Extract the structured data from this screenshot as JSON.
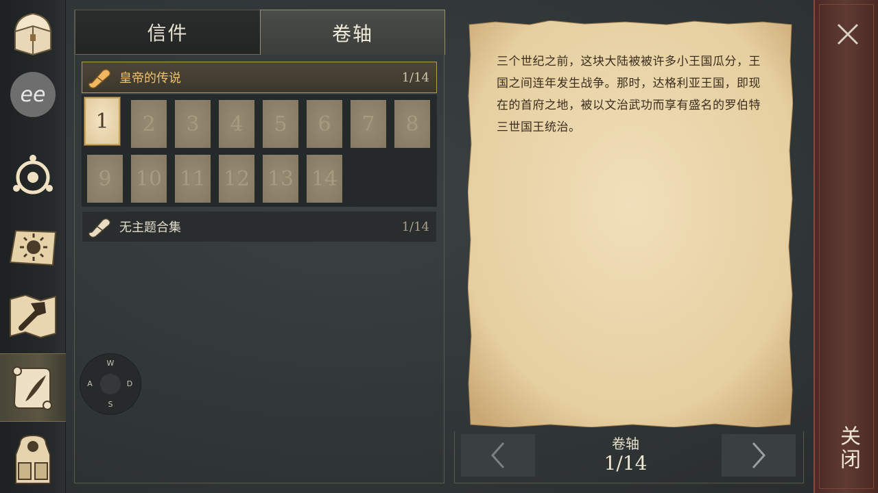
{
  "sidebar": {
    "items": [
      {
        "name": "chest-icon",
        "active": false
      },
      {
        "name": "ee-logo-icon",
        "active": false
      },
      {
        "name": "rune-circle-icon",
        "active": false
      },
      {
        "name": "sun-book-icon",
        "active": false
      },
      {
        "name": "map-hammer-icon",
        "active": false
      },
      {
        "name": "scroll-quill-icon",
        "active": true
      },
      {
        "name": "backpack-icon",
        "active": false
      }
    ]
  },
  "tabs": {
    "letters": "信件",
    "scrolls": "卷轴",
    "active": "scrolls"
  },
  "categories": [
    {
      "title": "皇帝的传说",
      "count": "1/14",
      "selected": true
    },
    {
      "title": "无主题合集",
      "count": "1/14",
      "selected": false
    }
  ],
  "pages": {
    "row1": [
      "1",
      "2",
      "3",
      "4",
      "5",
      "6",
      "7",
      "8"
    ],
    "row2": [
      "9",
      "10",
      "11",
      "12",
      "13",
      "14"
    ],
    "read_count": 1
  },
  "compass": {
    "up": "W",
    "left": "A",
    "right": "D",
    "down": "S"
  },
  "document": {
    "text": "三个世纪之前，这块大陆被被许多小王国瓜分，王国之间连年发生战争。那时，达格利亚王国，即现在的首府之地，被以文治武功而享有盛名的罗伯特三世国王统治。"
  },
  "navigator": {
    "label": "卷轴",
    "page": "1/14"
  },
  "close": {
    "label": "关闭"
  },
  "colors": {
    "gold_accent": "#c9a55c",
    "category_title_selected": "#f0c070",
    "close_strip": "#5e3a32",
    "parchment": "#ead6ae"
  }
}
